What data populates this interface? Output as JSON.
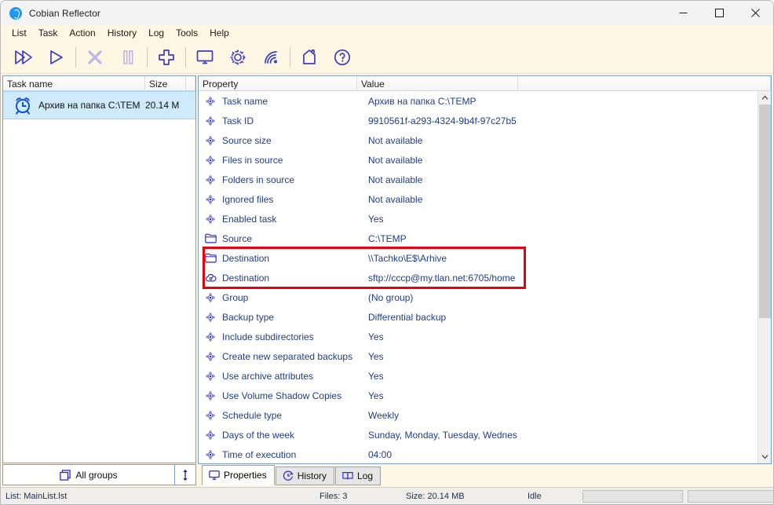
{
  "window": {
    "title": "Cobian Reflector",
    "app_icon": "cobian-logo-icon",
    "minimize_label": "Minimize",
    "maximize_label": "Maximize",
    "close_label": "Close"
  },
  "menu": {
    "items": [
      {
        "label": "List"
      },
      {
        "label": "Task"
      },
      {
        "label": "Action"
      },
      {
        "label": "History"
      },
      {
        "label": "Log"
      },
      {
        "label": "Tools"
      },
      {
        "label": "Help"
      }
    ]
  },
  "toolbar": {
    "accent": "#3b3bc8",
    "disabled_color": "#b9b6e8",
    "buttons": [
      {
        "name": "run-all-tasks-button",
        "icon": "double-play-icon",
        "enabled": true
      },
      {
        "name": "run-selected-task-button",
        "icon": "play-icon",
        "enabled": true
      },
      {
        "name": "stop-button",
        "icon": "stop-x-icon",
        "enabled": false
      },
      {
        "name": "pause-button",
        "icon": "pause-icon",
        "enabled": false
      },
      {
        "name": "new-task-button",
        "icon": "plus-icon",
        "enabled": true
      },
      {
        "name": "properties-button",
        "icon": "monitor-icon",
        "enabled": true
      },
      {
        "name": "options-button",
        "icon": "gear-icon",
        "enabled": true
      },
      {
        "name": "remote-connection-button",
        "icon": "wifi-signal-icon",
        "enabled": true
      },
      {
        "name": "home-button",
        "icon": "house-icon",
        "enabled": true
      },
      {
        "name": "help-button",
        "icon": "question-circle-icon",
        "enabled": true
      }
    ]
  },
  "task_list": {
    "columns": [
      "Task name",
      "Size"
    ],
    "rows": [
      {
        "icon": "alarm-clock-icon",
        "name": "Архив на папка C:\\TEM",
        "size": "20.14 M",
        "selected": true
      }
    ],
    "all_groups_label": "All groups",
    "all_groups_icon": "stacked-windows-icon",
    "resize_icon": "vertical-resize-icon"
  },
  "properties": {
    "columns": [
      "Property",
      "Value"
    ],
    "highlight_color": "#e8000d",
    "rows": [
      {
        "icon": "property-bullet-icon",
        "label": "Task name",
        "value": "Архив на папка C:\\TEMP"
      },
      {
        "icon": "property-bullet-icon",
        "label": "Task ID",
        "value": "9910561f-a293-4324-9b4f-97c27b5"
      },
      {
        "icon": "property-bullet-icon",
        "label": "Source size",
        "value": "Not available"
      },
      {
        "icon": "property-bullet-icon",
        "label": "Files in source",
        "value": "Not available"
      },
      {
        "icon": "property-bullet-icon",
        "label": "Folders in source",
        "value": "Not available"
      },
      {
        "icon": "property-bullet-icon",
        "label": "Ignored files",
        "value": "Not available"
      },
      {
        "icon": "property-bullet-icon",
        "label": "Enabled task",
        "value": "Yes"
      },
      {
        "icon": "folder-icon",
        "label": "Source",
        "value": "C:\\TEMP"
      },
      {
        "icon": "folder-icon",
        "label": "Destination",
        "value": "\\\\Tachko\\E$\\Arhive",
        "highlighted": true
      },
      {
        "icon": "cloud-icon",
        "label": "Destination",
        "value": "sftp://cccp@my.tlan.net:6705/home",
        "highlighted": true
      },
      {
        "icon": "property-bullet-icon",
        "label": "Group",
        "value": "(No group)"
      },
      {
        "icon": "property-bullet-icon",
        "label": "Backup type",
        "value": "Differential backup"
      },
      {
        "icon": "property-bullet-icon",
        "label": "Include subdirectories",
        "value": "Yes"
      },
      {
        "icon": "property-bullet-icon",
        "label": "Create new separated backups",
        "value": "Yes"
      },
      {
        "icon": "property-bullet-icon",
        "label": "Use archive attributes",
        "value": "Yes"
      },
      {
        "icon": "property-bullet-icon",
        "label": "Use Volume Shadow Copies",
        "value": "Yes"
      },
      {
        "icon": "property-bullet-icon",
        "label": "Schedule type",
        "value": "Weekly"
      },
      {
        "icon": "property-bullet-icon",
        "label": "Days of the week",
        "value": "Sunday, Monday, Tuesday, Wednes"
      },
      {
        "icon": "property-bullet-icon",
        "label": "Time of execution",
        "value": "04:00"
      }
    ]
  },
  "tabs": [
    {
      "label": "Properties",
      "icon": "monitor-icon",
      "active": true
    },
    {
      "label": "History",
      "icon": "clock-icon",
      "active": false
    },
    {
      "label": "Log",
      "icon": "book-icon",
      "active": false
    }
  ],
  "status_bar": {
    "list": "List: MainList.lst",
    "files": "Files: 3",
    "size": "Size: 20.14 MB",
    "state": "Idle"
  }
}
